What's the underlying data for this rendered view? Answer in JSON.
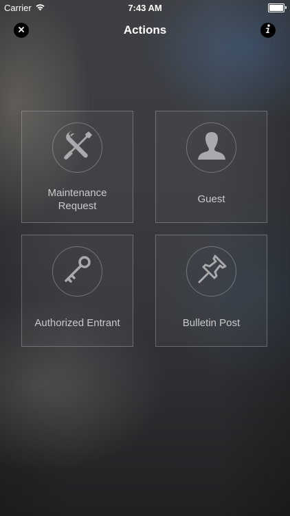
{
  "status_bar": {
    "carrier": "Carrier",
    "time": "7:43 AM",
    "wifi_icon": "wifi-icon",
    "battery_icon": "battery-icon"
  },
  "nav": {
    "title": "Actions",
    "close_icon": "close-icon",
    "info_icon": "info-icon"
  },
  "actions": [
    {
      "label_lines": [
        "Maintenance",
        "Request"
      ],
      "icon": "tools-icon"
    },
    {
      "label": "Guest",
      "icon": "person-icon"
    },
    {
      "label": "Authorized Entrant",
      "icon": "key-icon"
    },
    {
      "label": "Bulletin Post",
      "icon": "pushpin-icon"
    }
  ],
  "colors": {
    "tile_border": "#c8c8cd",
    "label_text": "#c9cacc",
    "icon_fill": "#a9aaad",
    "title_text": "#ffffff"
  }
}
